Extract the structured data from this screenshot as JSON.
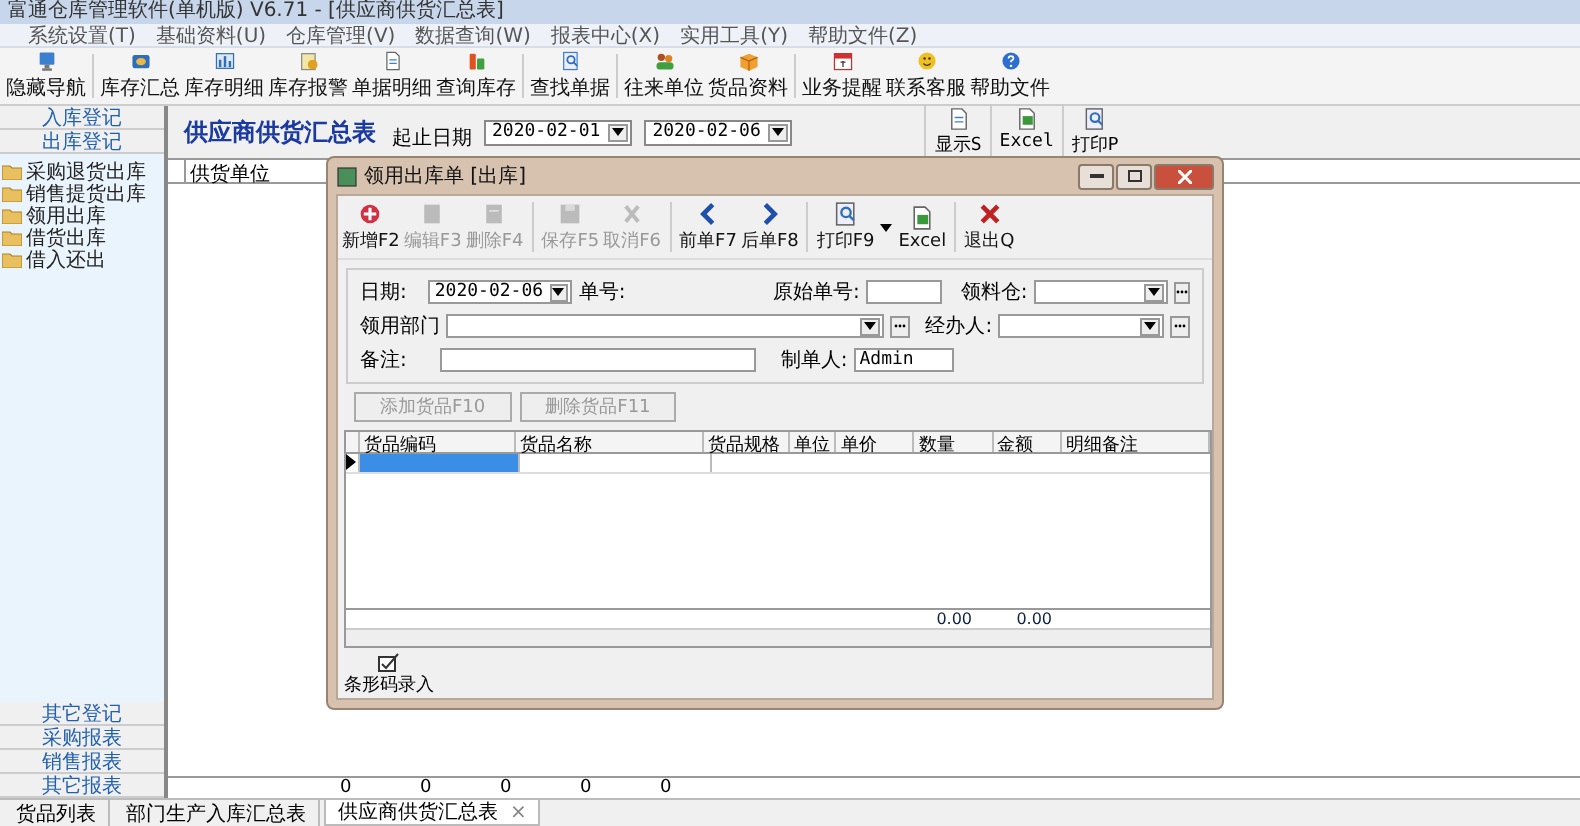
{
  "window": {
    "title": "富通仓库管理软件(单机版) V6.71 - [供应商供货汇总表]"
  },
  "menu": [
    "系统设置(T)",
    "基础资料(U)",
    "仓库管理(V)",
    "数据查询(W)",
    "报表中心(X)",
    "实用工具(Y)",
    "帮助文件(Z)"
  ],
  "toolbar": [
    [
      {
        "label": "隐藏导航",
        "kind": "monitor"
      }
    ],
    [
      {
        "label": "库存汇总",
        "kind": "boxes"
      },
      {
        "label": "库存明细",
        "kind": "chart"
      },
      {
        "label": "库存报警",
        "kind": "alarm"
      },
      {
        "label": "单据明细",
        "kind": "doc"
      },
      {
        "label": "查询库存",
        "kind": "stock"
      }
    ],
    [
      {
        "label": "查找单据",
        "kind": "find"
      }
    ],
    [
      {
        "label": "往来单位",
        "kind": "people"
      },
      {
        "label": "货品资料",
        "kind": "package"
      }
    ],
    [
      {
        "label": "业务提醒",
        "kind": "calendar"
      },
      {
        "label": "联系客服",
        "kind": "smiley"
      },
      {
        "label": "帮助文件",
        "kind": "help"
      }
    ]
  ],
  "sidebar": {
    "headers": [
      "入库登记",
      "出库登记"
    ],
    "items": [
      "采购退货出库",
      "销售提货出库",
      "领用出库",
      "借货出库",
      "借入还出"
    ],
    "footer": [
      "其它登记",
      "采购报表",
      "销售报表",
      "其它报表"
    ]
  },
  "report": {
    "title": "供应商供货汇总表",
    "date_label": "起止日期",
    "date_from": "2020-02-01",
    "date_to": "2020-02-06",
    "buttons": [
      {
        "label": "显示S",
        "kind": "doc"
      },
      {
        "label": "Excel",
        "kind": "excel"
      },
      {
        "label": "打印P",
        "kind": "print"
      }
    ],
    "columns": [
      "供货单位"
    ],
    "totals": [
      "0",
      "0",
      "0",
      "0",
      "0"
    ]
  },
  "dialog": {
    "title": "领用出库单 [出库]",
    "toolbar": [
      [
        {
          "label": "新增F2",
          "kind": "add",
          "disabled": false
        },
        {
          "label": "编辑F3",
          "kind": "edit",
          "disabled": true
        },
        {
          "label": "删除F4",
          "kind": "delete",
          "disabled": true
        }
      ],
      [
        {
          "label": "保存F5",
          "kind": "save",
          "disabled": true
        },
        {
          "label": "取消F6",
          "kind": "cancel",
          "disabled": true
        }
      ],
      [
        {
          "label": "前单F7",
          "kind": "prev",
          "disabled": false
        },
        {
          "label": "后单F8",
          "kind": "next",
          "disabled": false
        }
      ],
      [
        {
          "label": "打印F9",
          "kind": "print",
          "disabled": false,
          "has_menu": true
        },
        {
          "label": "Excel",
          "kind": "excel",
          "disabled": false
        }
      ],
      [
        {
          "label": "退出Q",
          "kind": "exit",
          "disabled": false
        }
      ]
    ],
    "form": {
      "date_label": "日期:",
      "date": "2020-02-06",
      "number_label": "单号:",
      "original_label": "原始单号:",
      "warehouse_label": "领料仓:",
      "dept_label": "领用部门",
      "handler_label": "经办人:",
      "note_label": "备注:",
      "creator_label": "制单人:",
      "creator": "Admin"
    },
    "buttons": [
      {
        "label": "添加货品F10",
        "disabled": true
      },
      {
        "label": "删除货品F11",
        "disabled": true
      }
    ],
    "columns": [
      "货品编码",
      "货品名称",
      "货品规格",
      "单位",
      "单价",
      "数量",
      "金额",
      "明细备注"
    ],
    "totals": [
      "0.00",
      "0.00"
    ],
    "barcode": "条形码录入"
  },
  "tabs": [
    {
      "label": "货品列表",
      "selected": false
    },
    {
      "label": "部门生产入库汇总表",
      "selected": false
    },
    {
      "label": "供应商供货汇总表",
      "selected": true,
      "close": "×"
    }
  ]
}
